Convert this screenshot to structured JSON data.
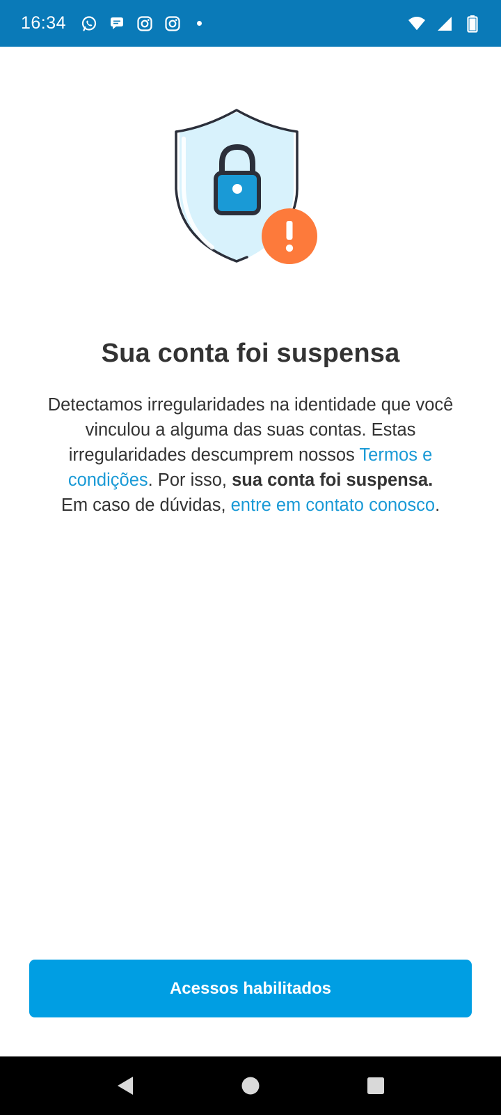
{
  "status_bar": {
    "time": "16:34",
    "left_icons": [
      "whatsapp-icon",
      "chat-bubble-icon",
      "instagram-icon",
      "instagram-icon",
      "notification-dot"
    ],
    "right_icons": [
      "wifi-icon",
      "cellular-signal-icon",
      "battery-icon"
    ],
    "background_color": "#0a7ab8"
  },
  "illustration": {
    "icons": [
      "shield-icon",
      "padlock-icon",
      "alert-badge-icon"
    ],
    "shield_fill": "#d8f2fc",
    "lock_color": "#1a9ad6",
    "alert_color": "#fd7a3b"
  },
  "title": "Sua conta foi suspensa",
  "body": {
    "text_1": "Detectamos irregularidades na identidade que você vinculou a alguma das suas contas. Estas irregularidades descumprem nossos ",
    "terms_link": "Termos e condições",
    "text_2": ". Por isso, ",
    "bold_text": "sua conta foi suspensa.",
    "text_3": "Em caso de dúvidas, ",
    "contact_link": "entre em contato conosco",
    "text_4": "."
  },
  "primary_button": {
    "label": "Acessos habilitados",
    "color": "#009ee3"
  },
  "nav_bar": {
    "buttons": [
      "back-icon",
      "home-icon",
      "recents-icon"
    ]
  }
}
